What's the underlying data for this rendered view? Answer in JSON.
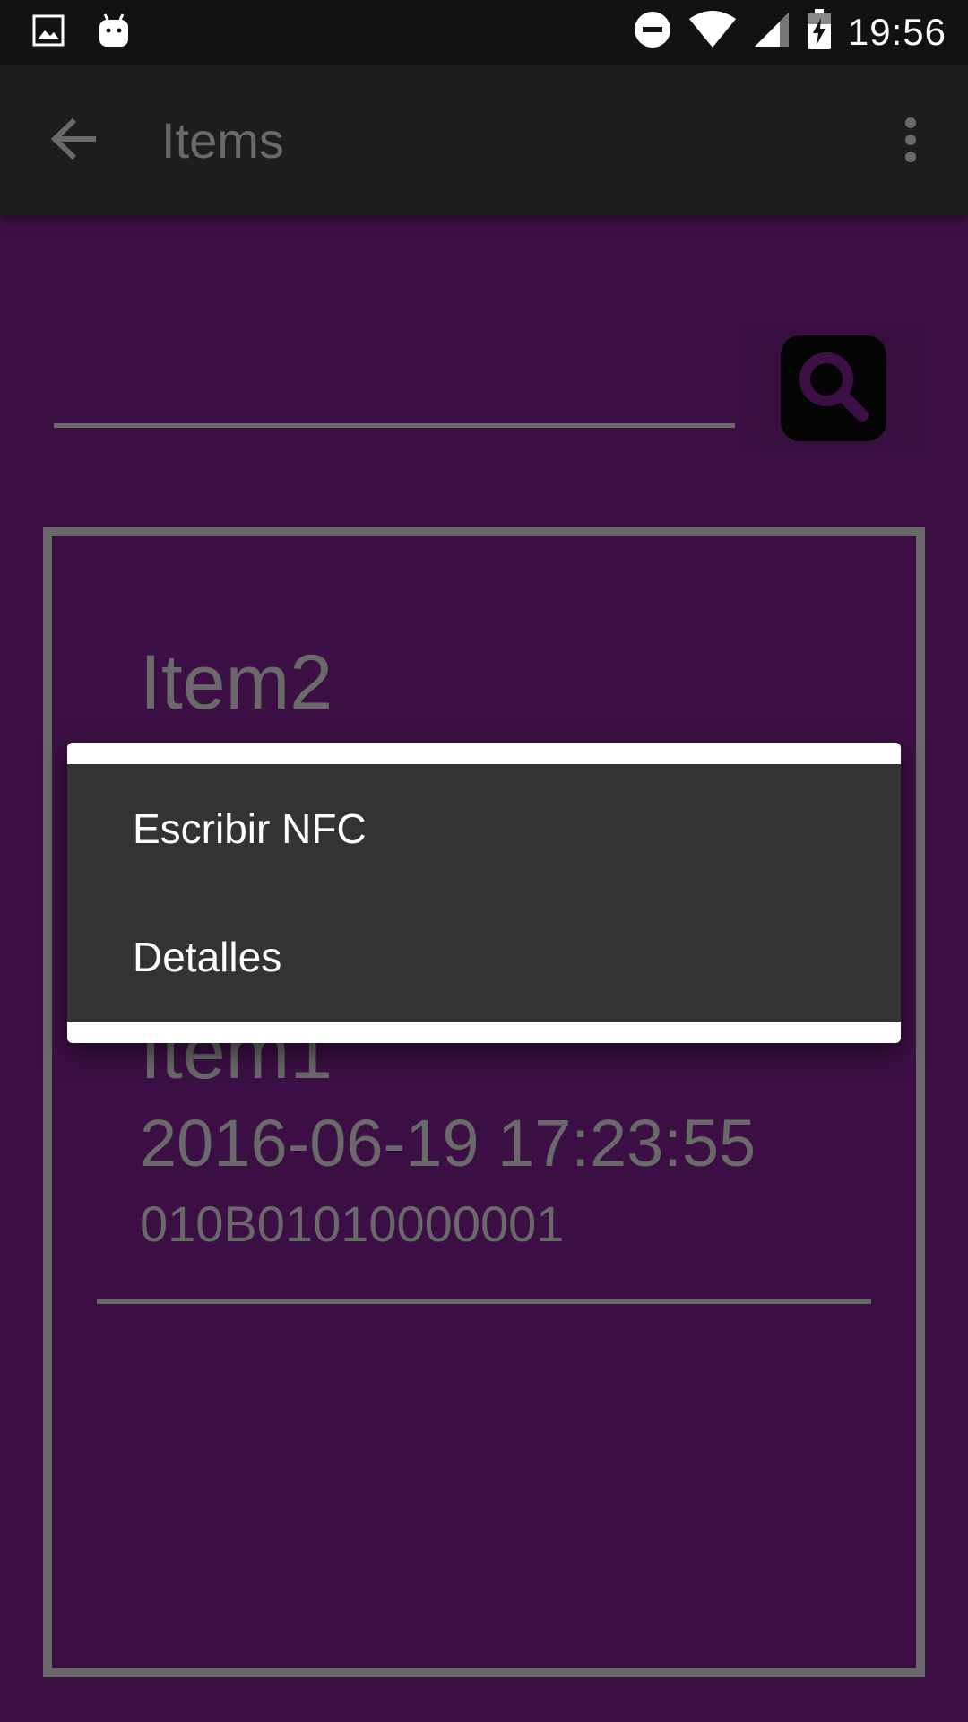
{
  "status_bar": {
    "time": "19:56",
    "left_icons": [
      "gallery-icon",
      "android-icon"
    ],
    "right_icons": [
      "do-not-disturb-icon",
      "wifi-icon",
      "cell-signal-icon",
      "battery-charging-icon"
    ]
  },
  "app_bar": {
    "title": "Items",
    "back_icon": "arrow-back-icon",
    "overflow_icon": "more-vert-icon"
  },
  "search": {
    "value": "",
    "placeholder": "",
    "button_icon": "search-icon"
  },
  "items": [
    {
      "name": "Item2",
      "date": "",
      "code": ""
    },
    {
      "name": "Item1",
      "date": "2016-06-19 17:23:55",
      "code": "010B01010000001"
    }
  ],
  "context_menu": {
    "items": [
      {
        "label": "Escribir NFC"
      },
      {
        "label": "Detalles"
      }
    ]
  },
  "colors": {
    "background": "#3d1045",
    "app_bar": "#1e1e1e",
    "status_bar": "#121212",
    "muted_text": "#6a6a6a",
    "menu_background": "#333333"
  }
}
